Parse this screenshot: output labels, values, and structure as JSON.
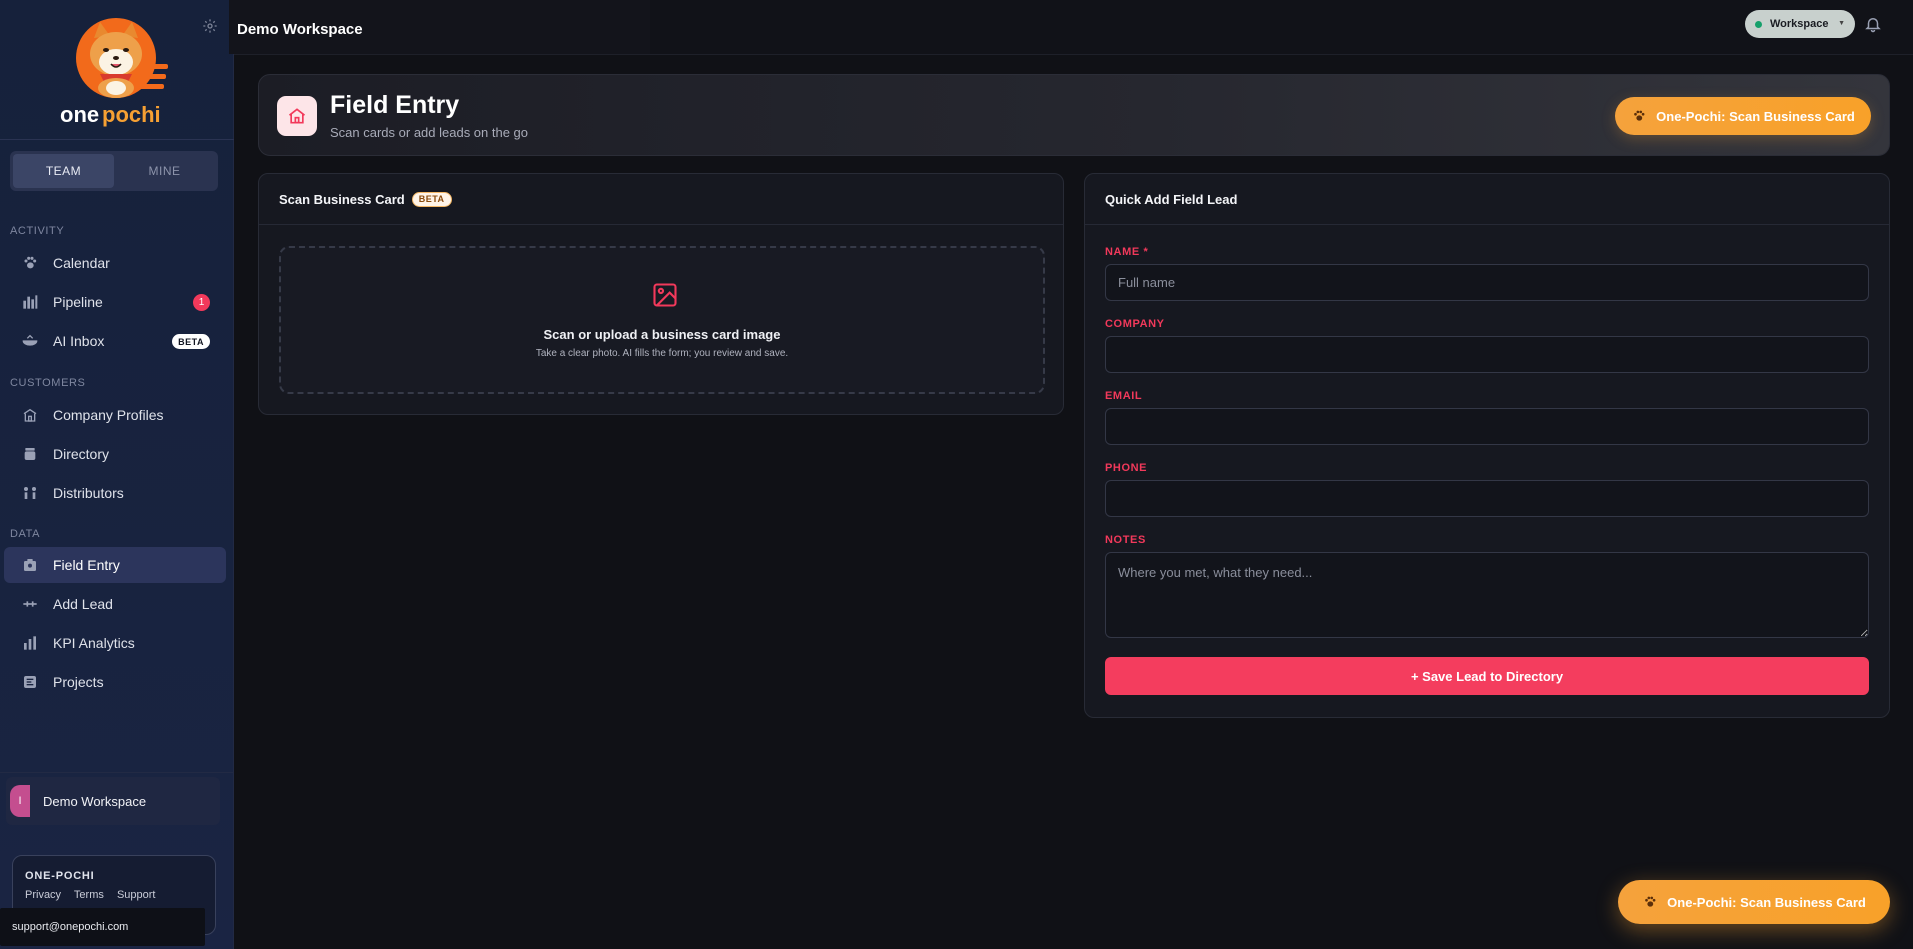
{
  "brand": {
    "logo_text_1": "one",
    "logo_text_2": "pochi"
  },
  "sidebar": {
    "toggle": {
      "team": "TEAM",
      "mine": "MINE"
    },
    "sections": {
      "activity": "ACTIVITY",
      "customers": "CUSTOMERS",
      "data": "DATA"
    },
    "items": {
      "calendar": "Calendar",
      "pipeline": "Pipeline",
      "pipeline_badge": "1",
      "ai_inbox": "AI Inbox",
      "ai_inbox_badge": "BETA",
      "company_profiles": "Company Profiles",
      "directory": "Directory",
      "distributors": "Distributors",
      "field_entry": "Field Entry",
      "add_lead": "Add Lead",
      "kpi_analytics": "KPI Analytics",
      "projects": "Projects"
    },
    "workspace": {
      "initial": "I",
      "name": "Demo Workspace"
    },
    "footer": {
      "brand": "ONE-POCHI",
      "links": [
        "Privacy",
        "Terms",
        "Support"
      ],
      "support_email": "support@onepochi.com"
    }
  },
  "topbar": {
    "title": "Demo Workspace",
    "workspace_pill": "Workspace"
  },
  "hero": {
    "title": "Field Entry",
    "subtitle": "Scan cards or add leads on the go",
    "scan_button": "One-Pochi: Scan Business Card"
  },
  "scan_card": {
    "title": "Scan Business Card",
    "badge": "BETA",
    "dropzone_title": "Scan or upload a business card image",
    "dropzone_sub": "Take a clear photo. AI fills the form; you review and save."
  },
  "quick_add": {
    "title": "Quick Add Field Lead",
    "name_label": "NAME *",
    "name_placeholder": "Full name",
    "company_label": "COMPANY",
    "email_label": "EMAIL",
    "phone_label": "PHONE",
    "notes_label": "NOTES",
    "notes_placeholder": "Where you met, what they need...",
    "save_button": "+ Save Lead to Directory"
  },
  "floating_button": "One-Pochi: Scan Business Card",
  "colors": {
    "accent": "#f43d5e",
    "orange": "#f5a23c",
    "sidebar_bg": "#16213b",
    "page_bg": "#101116"
  }
}
